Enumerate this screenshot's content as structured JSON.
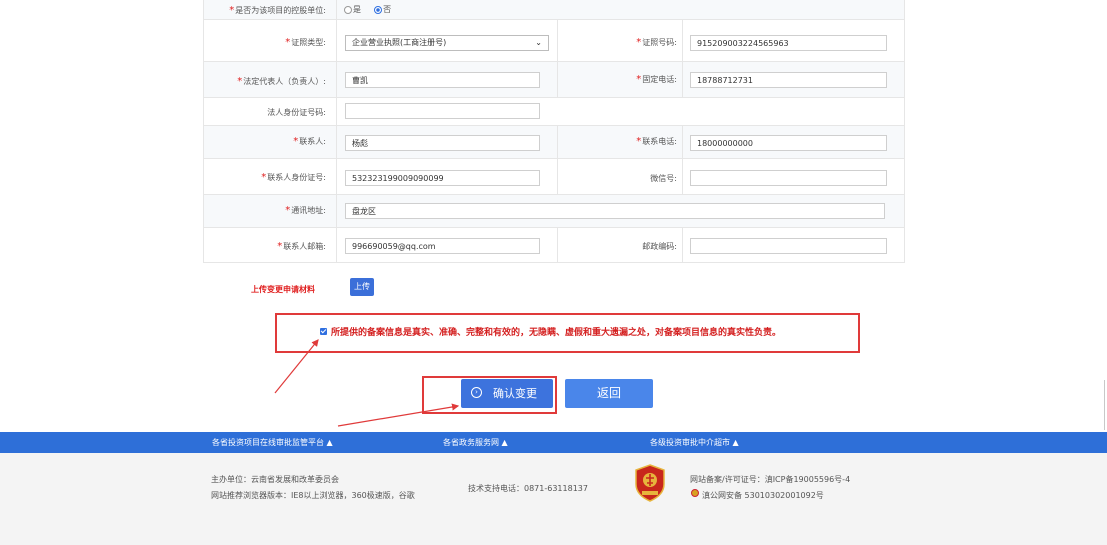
{
  "form": {
    "row0": {
      "label": "是否为该项目的控股单位:",
      "option_yes": "是",
      "option_no": "否",
      "selected": "否"
    },
    "row1": {
      "left_label": "证照类型:",
      "left_value": "企业营业执照(工商注册号)",
      "right_label": "证照号码:",
      "right_value": "915209003224565963"
    },
    "row2": {
      "left_label": "法定代表人（负责人）:",
      "left_value": "曹凯",
      "right_label": "固定电话:",
      "right_value": "18788712731"
    },
    "row3": {
      "left_label": "法人身份证号码:",
      "left_value": ""
    },
    "row4": {
      "left_label": "联系人:",
      "left_value": "杨彪",
      "right_label": "联系电话:",
      "right_value": "18000000000"
    },
    "row5": {
      "left_label": "联系人身份证号:",
      "left_value": "532323199009090099",
      "right_label": "微信号:",
      "right_value": ""
    },
    "row6": {
      "left_label": "通讯地址:",
      "left_value": "盘龙区"
    },
    "row7": {
      "left_label": "联系人邮箱:",
      "left_value": "996690059@qq.com",
      "right_label": "邮政编码:",
      "right_value": ""
    }
  },
  "upload": {
    "label": "上传变更申请材料",
    "button": "上传"
  },
  "declaration": {
    "checked": true,
    "text": "所提供的备案信息是真实、准确、完整和有效的，无隐瞒、虚假和重大遗漏之处，对备案项目信息的真实性负责。"
  },
  "actions": {
    "confirm": "确认变更",
    "back": "返回"
  },
  "footer": {
    "links": [
      "各省投资项目在线审批监管平台",
      "各省政务服务网",
      "各级投资审批中介超市"
    ],
    "host_unit": "主办单位：云南省发展和改革委员会",
    "browser_tip": "网站推荐浏览器版本：IE8以上浏览器，360极速版，谷歌",
    "support_phone": "技术支持电话：0871-63118137",
    "icp": "网站备案/许可证号：滇ICP备19005596号-4",
    "police": "滇公网安备 53010302001092号"
  },
  "colors": {
    "accent": "#3d73dd",
    "footer_bar": "#2e6fd8",
    "alert_red": "#e03a3a",
    "required_star": "#e02020"
  }
}
